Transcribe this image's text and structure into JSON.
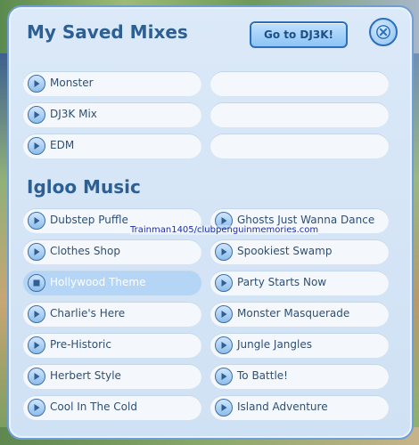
{
  "header": {
    "title": "My Saved Mixes",
    "dj_button_label": "Go to DJ3K!"
  },
  "saved_mixes": [
    {
      "label": "Monster"
    },
    {
      "label": "DJ3K Mix"
    },
    {
      "label": "EDM"
    }
  ],
  "igloo_music": {
    "title": "Igloo Music",
    "left": [
      {
        "label": "Dubstep Puffle"
      },
      {
        "label": "Clothes Shop"
      },
      {
        "label": "Hollywood Theme",
        "state": "playing"
      },
      {
        "label": "Charlie's Here"
      },
      {
        "label": "Pre-Historic"
      },
      {
        "label": "Herbert Style"
      },
      {
        "label": "Cool In The Cold"
      }
    ],
    "right": [
      {
        "label": "Ghosts Just Wanna Dance"
      },
      {
        "label": "Spookiest Swamp"
      },
      {
        "label": "Party Starts Now"
      },
      {
        "label": "Monster Masquerade"
      },
      {
        "label": "Jungle Jangles"
      },
      {
        "label": "To Battle!"
      },
      {
        "label": "Island Adventure"
      }
    ]
  },
  "watermark": "Trainman1405/clubpenguinmemories.com",
  "colors": {
    "accent": "#2d5f93",
    "panel": "#dbe9f8",
    "active_slot": "#b4d5f6"
  }
}
